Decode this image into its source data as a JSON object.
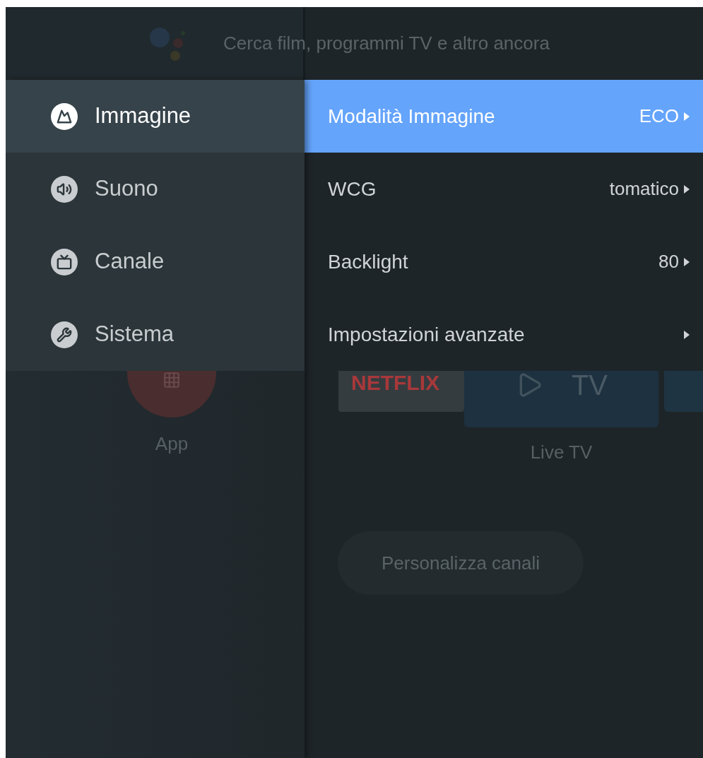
{
  "search": {
    "placeholder": "Cerca film, programmi TV e altro ancora"
  },
  "home": {
    "apps_label": "App",
    "tiles": [
      {
        "kind": "netflix",
        "label": "NETFLIX"
      },
      {
        "kind": "tv",
        "label": "TV",
        "caption": "Live TV"
      }
    ],
    "customize_button": "Personalizza canali"
  },
  "categories": [
    {
      "kind": "picture",
      "label": "Immagine",
      "selected": true
    },
    {
      "kind": "sound",
      "label": "Suono",
      "selected": false
    },
    {
      "kind": "channel",
      "label": "Canale",
      "selected": false
    },
    {
      "kind": "system",
      "label": "Sistema",
      "selected": false
    }
  ],
  "settings": [
    {
      "label": "Modalità Immagine",
      "value": "ECO",
      "selected": true
    },
    {
      "label": "WCG",
      "value": "tomatico",
      "selected": false
    },
    {
      "label": "Backlight",
      "value": "80",
      "selected": false
    },
    {
      "label": "Impostazioni avanzate",
      "selected": false
    }
  ]
}
